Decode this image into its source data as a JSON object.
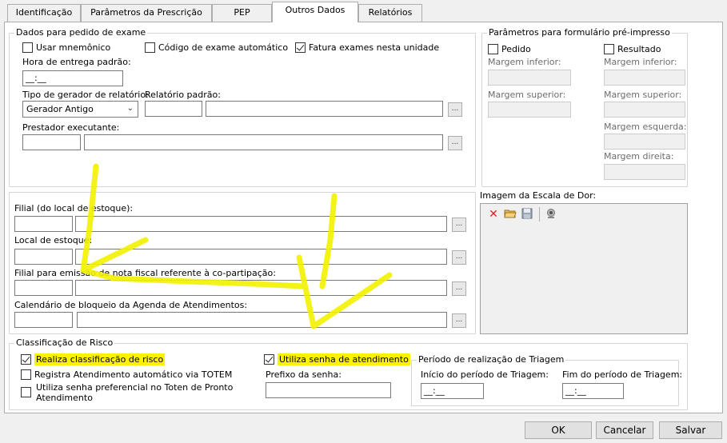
{
  "tabs": [
    {
      "label": "Identificação"
    },
    {
      "label": "Parâmetros da Prescrição"
    },
    {
      "label": "PEP"
    },
    {
      "label": "Outros Dados"
    },
    {
      "label": "Relatórios"
    }
  ],
  "exam": {
    "title": "Dados para pedido de exame",
    "mnemonic_label": "Usar mnemônico",
    "auto_code_label": "Código de exame automático",
    "fatura_label": "Fatura exames nesta unidade",
    "hora_label": "Hora de entrega padrão:",
    "hora_value": "__:__",
    "tipo_label": "Tipo de gerador de relatório:",
    "tipo_value": "Gerador Antigo",
    "relatorio_label": "Relatório padrão:",
    "prestador_label": "Prestador executante:",
    "dots": "..."
  },
  "preprint": {
    "title": "Parâmetros para formulário pré-impresso",
    "pedido_label": "Pedido",
    "resultado_label": "Resultado",
    "margem_inferior": "Margem inferior:",
    "margem_superior": "Margem superior:",
    "margem_esquerda": "Margem esquerda:",
    "margem_direita": "Margem direita:"
  },
  "stock": {
    "filial_label": "Filial (do local de estoque):",
    "local_label": "Local de estoque:",
    "filial_nf_label": "Filial para emissão de nota fiscal referente à co-partipação:",
    "calendario_label": "Calendário de bloqueio da Agenda de Atendimentos:"
  },
  "pain": {
    "title": "Imagem da Escala de Dor:"
  },
  "risk": {
    "title": "Classificação de Risco",
    "realiza_label": "Realiza classificação de risco",
    "registra_label": "Registra Atendimento automático via TOTEM",
    "senha_pref_line1": "Utiliza senha preferencial no Toten de Pronto",
    "senha_pref_line2": "Atendimento",
    "utiliza_senha_label": "Utiliza senha de atendimento",
    "prefixo_label": "Prefixo da senha:"
  },
  "triagem": {
    "title": "Período de realização de Triagem",
    "inicio_label": "Início do período de Triagem:",
    "fim_label": "Fim do período de Triagem:",
    "inicio_value": "__:__",
    "fim_value": "__:__"
  },
  "footer": {
    "ok": "OK",
    "cancel": "Cancelar",
    "save": "Salvar"
  },
  "colors": {
    "highlight": "#fff200",
    "delete_icon": "#e02020"
  }
}
